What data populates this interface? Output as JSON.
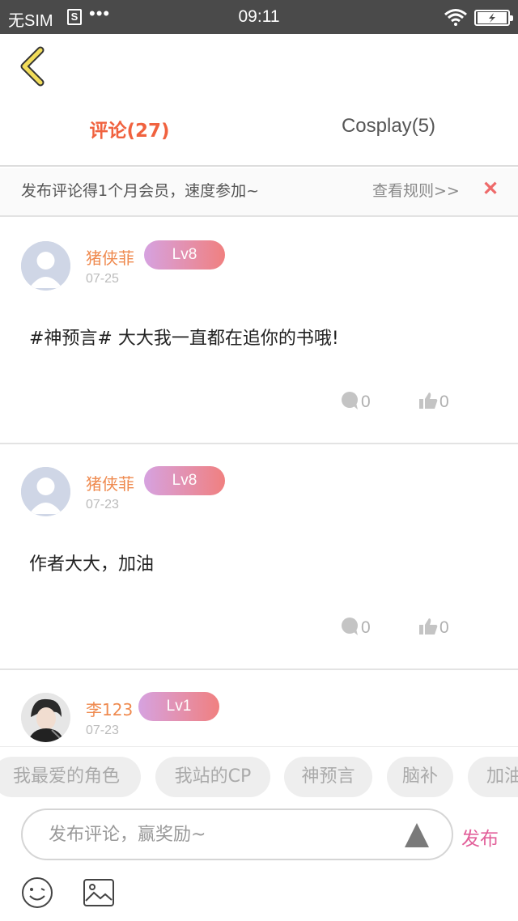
{
  "status_bar": {
    "carrier": "无SIM",
    "sim_badge": "S",
    "dots": "•••",
    "time": "09:11"
  },
  "tabs": [
    {
      "label": "评论",
      "count": "(27)",
      "active": true
    },
    {
      "label": "Cosplay",
      "count": "(5)",
      "active": false
    }
  ],
  "banner": {
    "promo_text": "发布评论得1个月会员，速度参加~",
    "rules_link": "查看规则>>",
    "close_glyph": "✕"
  },
  "comments": [
    {
      "username": "猪侠菲",
      "level": "Lv8",
      "date": "07-25",
      "text": "#神预言# 大大我一直都在追你的书哦!",
      "replies": "0",
      "likes": "0",
      "avatar_type": "default"
    },
    {
      "username": "猪侠菲",
      "level": "Lv8",
      "date": "07-23",
      "text": "作者大大，加油",
      "replies": "0",
      "likes": "0",
      "avatar_type": "default"
    },
    {
      "username": "李123",
      "level": "Lv1",
      "date": "07-23",
      "text": "",
      "replies": "",
      "likes": "",
      "avatar_type": "photo"
    }
  ],
  "quick_tags": [
    "我最爱的角色",
    "我站的CP",
    "神预言",
    "脑补",
    "加油"
  ],
  "composer": {
    "placeholder": "发布评论，赢奖励~",
    "publish_label": "发布"
  },
  "colors": {
    "accent_orange": "#f0623f",
    "username_orange": "#ef8a4f",
    "publish_pink": "#e2609a",
    "back_arrow_yellow": "#f2dd5a"
  },
  "icons": [
    "back-arrow-icon",
    "wifi-icon",
    "battery-icon",
    "close-icon",
    "comment-bubble-icon",
    "thumbs-up-icon",
    "send-triangle-icon",
    "emoji-icon",
    "image-icon"
  ]
}
